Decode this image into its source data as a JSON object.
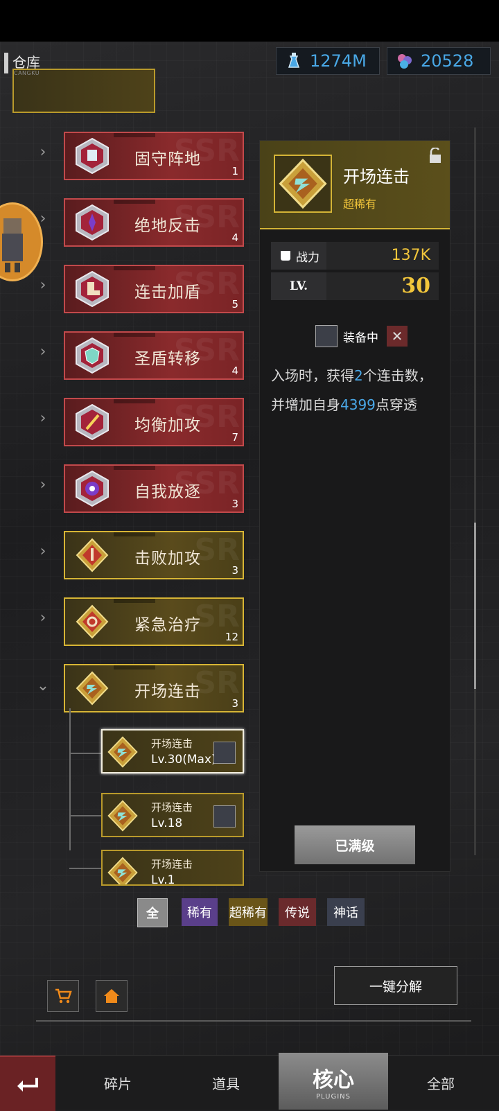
{
  "header": {
    "title": "仓库",
    "subtitle": "CANGKU"
  },
  "resources": [
    {
      "icon": "potion-icon",
      "value": "1274M"
    },
    {
      "icon": "gem-icon",
      "value": "20528"
    }
  ],
  "plugins": [
    {
      "name": "固守阵地",
      "count": "1",
      "rarity": "red"
    },
    {
      "name": "绝地反击",
      "count": "4",
      "rarity": "red"
    },
    {
      "name": "连击加盾",
      "count": "5",
      "rarity": "red"
    },
    {
      "name": "圣盾转移",
      "count": "4",
      "rarity": "red"
    },
    {
      "name": "均衡加攻",
      "count": "7",
      "rarity": "red"
    },
    {
      "name": "自我放逐",
      "count": "3",
      "rarity": "red"
    },
    {
      "name": "击败加攻",
      "count": "3",
      "rarity": "gold"
    },
    {
      "name": "紧急治疗",
      "count": "12",
      "rarity": "gold"
    },
    {
      "name": "开场连击",
      "count": "3",
      "rarity": "gold"
    }
  ],
  "sub_items": [
    {
      "name": "开场连击",
      "level": "Lv.30(Max)"
    },
    {
      "name": "开场连击",
      "level": "Lv.18"
    },
    {
      "name": "开场连击",
      "level": "Lv.1"
    }
  ],
  "detail": {
    "name": "开场连击",
    "rarity": "超稀有",
    "power_label": "战力",
    "power_value": "137K",
    "level_label": "LV.",
    "level_value": "30",
    "equipped_label": "装备中",
    "desc_1": "入场时，获得",
    "desc_num1": "2",
    "desc_2": "个连击数，并增加自身",
    "desc_num2": "4399",
    "desc_3": "点穿透",
    "max_button": "已满级"
  },
  "filters": [
    "全",
    "稀有",
    "超稀有",
    "传说",
    "神话"
  ],
  "decompose_button": "一键分解",
  "nav": {
    "tab1": "碎片",
    "tab2": "道具",
    "tab3": "核心",
    "tab3_sub": "PLUGINS",
    "tab4": "全部"
  }
}
